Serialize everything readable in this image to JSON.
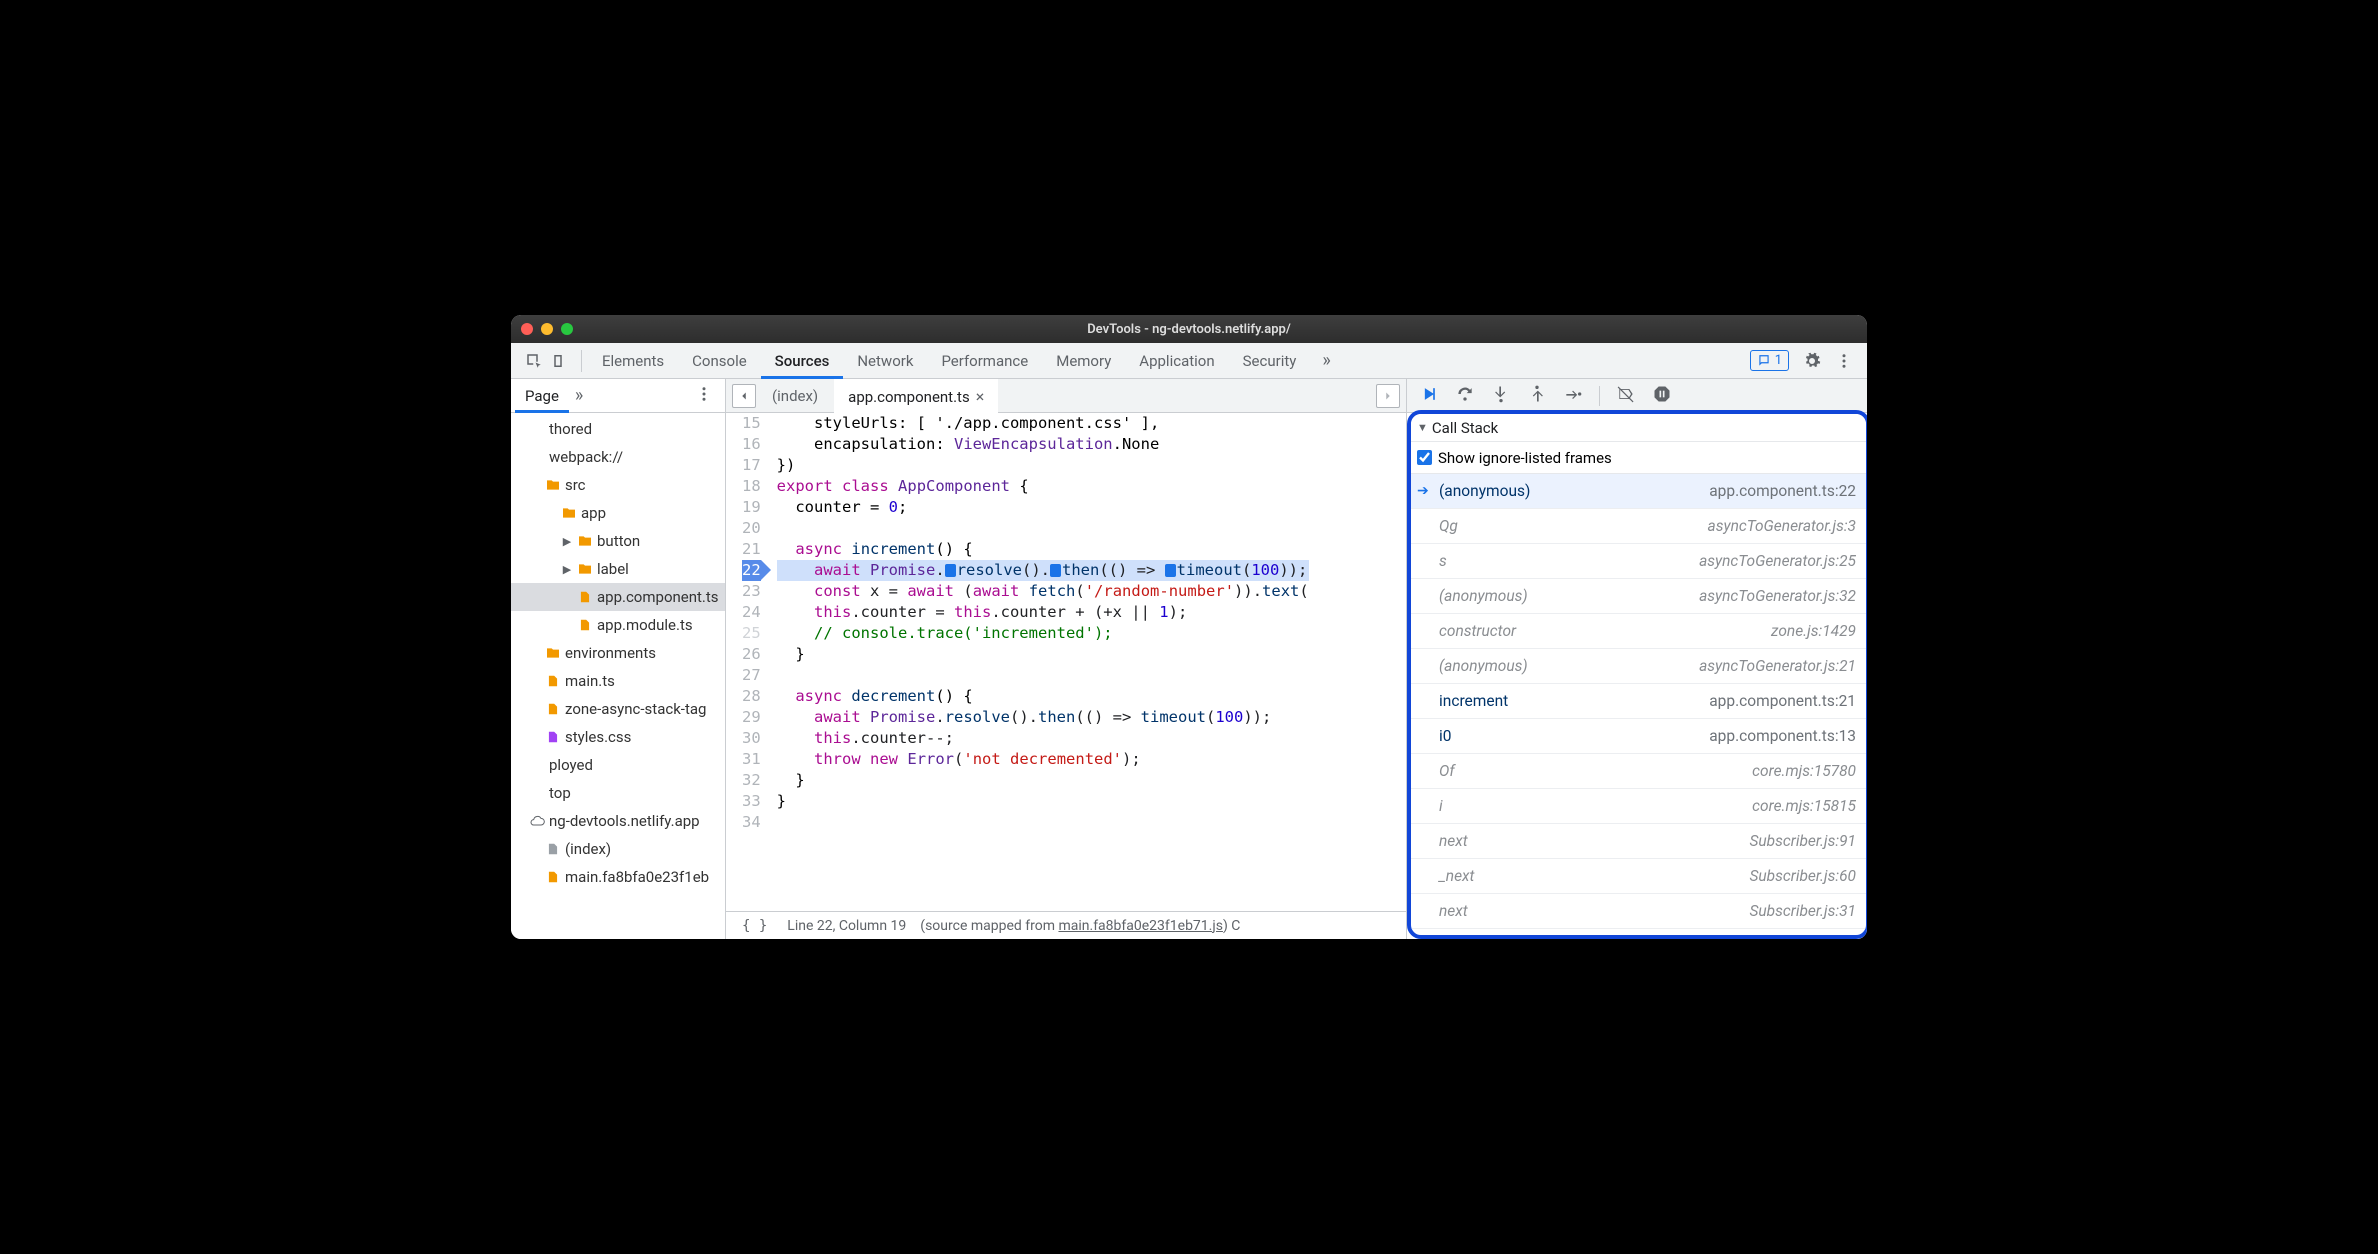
{
  "window": {
    "title": "DevTools - ng-devtools.netlify.app/"
  },
  "mainTabs": [
    "Elements",
    "Console",
    "Sources",
    "Network",
    "Performance",
    "Memory",
    "Application",
    "Security"
  ],
  "mainActive": "Sources",
  "issuesCount": "1",
  "left": {
    "subtabs": [
      "Page"
    ],
    "subtabActive": "Page",
    "rows": [
      {
        "indent": 0,
        "icon": "none",
        "label": "thored"
      },
      {
        "indent": 0,
        "icon": "none",
        "label": "webpack://"
      },
      {
        "indent": 1,
        "twisty": "",
        "icon": "folder",
        "label": "src"
      },
      {
        "indent": 2,
        "twisty": "",
        "icon": "folder",
        "label": "app"
      },
      {
        "indent": 3,
        "twisty": "▶",
        "icon": "folder",
        "label": "button"
      },
      {
        "indent": 3,
        "twisty": "▶",
        "icon": "folder",
        "label": "label"
      },
      {
        "indent": 3,
        "twisty": "",
        "icon": "file",
        "label": "app.component.ts",
        "selected": true
      },
      {
        "indent": 3,
        "twisty": "",
        "icon": "file",
        "label": "app.module.ts"
      },
      {
        "indent": 1,
        "twisty": "",
        "icon": "folder",
        "label": "environments"
      },
      {
        "indent": 1,
        "twisty": "",
        "icon": "file",
        "label": "main.ts"
      },
      {
        "indent": 1,
        "twisty": "",
        "icon": "file",
        "label": "zone-async-stack-tag"
      },
      {
        "indent": 1,
        "twisty": "",
        "icon": "file-purple",
        "label": "styles.css"
      },
      {
        "indent": 0,
        "icon": "none",
        "label": "ployed"
      },
      {
        "indent": 0,
        "icon": "none",
        "label": "top"
      },
      {
        "indent": 0,
        "twisty": "",
        "icon": "cloud",
        "label": "ng-devtools.netlify.app"
      },
      {
        "indent": 1,
        "twisty": "",
        "icon": "file-grey",
        "label": "(index)"
      },
      {
        "indent": 1,
        "twisty": "",
        "icon": "file",
        "label": "main.fa8bfa0e23f1eb"
      }
    ]
  },
  "editor": {
    "tabs": [
      {
        "label": "(index)",
        "active": false,
        "closable": false
      },
      {
        "label": "app.component.ts",
        "active": true,
        "closable": true
      }
    ],
    "firstLine": 15,
    "execLine": 22,
    "mutedLine": 25,
    "status": {
      "cursor": "Line 22, Column 19",
      "mapped_label": "(source mapped from ",
      "mapped_link": "main.fa8bfa0e23f1eb71.js",
      "trail": ")  C"
    }
  },
  "callstack": {
    "title": "Call Stack",
    "checkboxLabel": "Show ignore-listed frames",
    "frames": [
      {
        "fn": "(anonymous)",
        "loc": "app.component.ts:22",
        "current": true,
        "ign": false
      },
      {
        "fn": "Qg",
        "loc": "asyncToGenerator.js:3",
        "ign": true
      },
      {
        "fn": "s",
        "loc": "asyncToGenerator.js:25",
        "ign": true
      },
      {
        "fn": "(anonymous)",
        "loc": "asyncToGenerator.js:32",
        "ign": true
      },
      {
        "fn": "constructor",
        "loc": "zone.js:1429",
        "ign": true
      },
      {
        "fn": "(anonymous)",
        "loc": "asyncToGenerator.js:21",
        "ign": true
      },
      {
        "fn": "increment",
        "loc": "app.component.ts:21",
        "ign": false
      },
      {
        "fn": "i0",
        "loc": "app.component.ts:13",
        "ign": false
      },
      {
        "fn": "Of",
        "loc": "core.mjs:15780",
        "ign": true
      },
      {
        "fn": "i",
        "loc": "core.mjs:15815",
        "ign": true
      },
      {
        "fn": "next",
        "loc": "Subscriber.js:91",
        "ign": true
      },
      {
        "fn": "_next",
        "loc": "Subscriber.js:60",
        "ign": true
      },
      {
        "fn": "next",
        "loc": "Subscriber.js:31",
        "ign": true
      }
    ]
  }
}
